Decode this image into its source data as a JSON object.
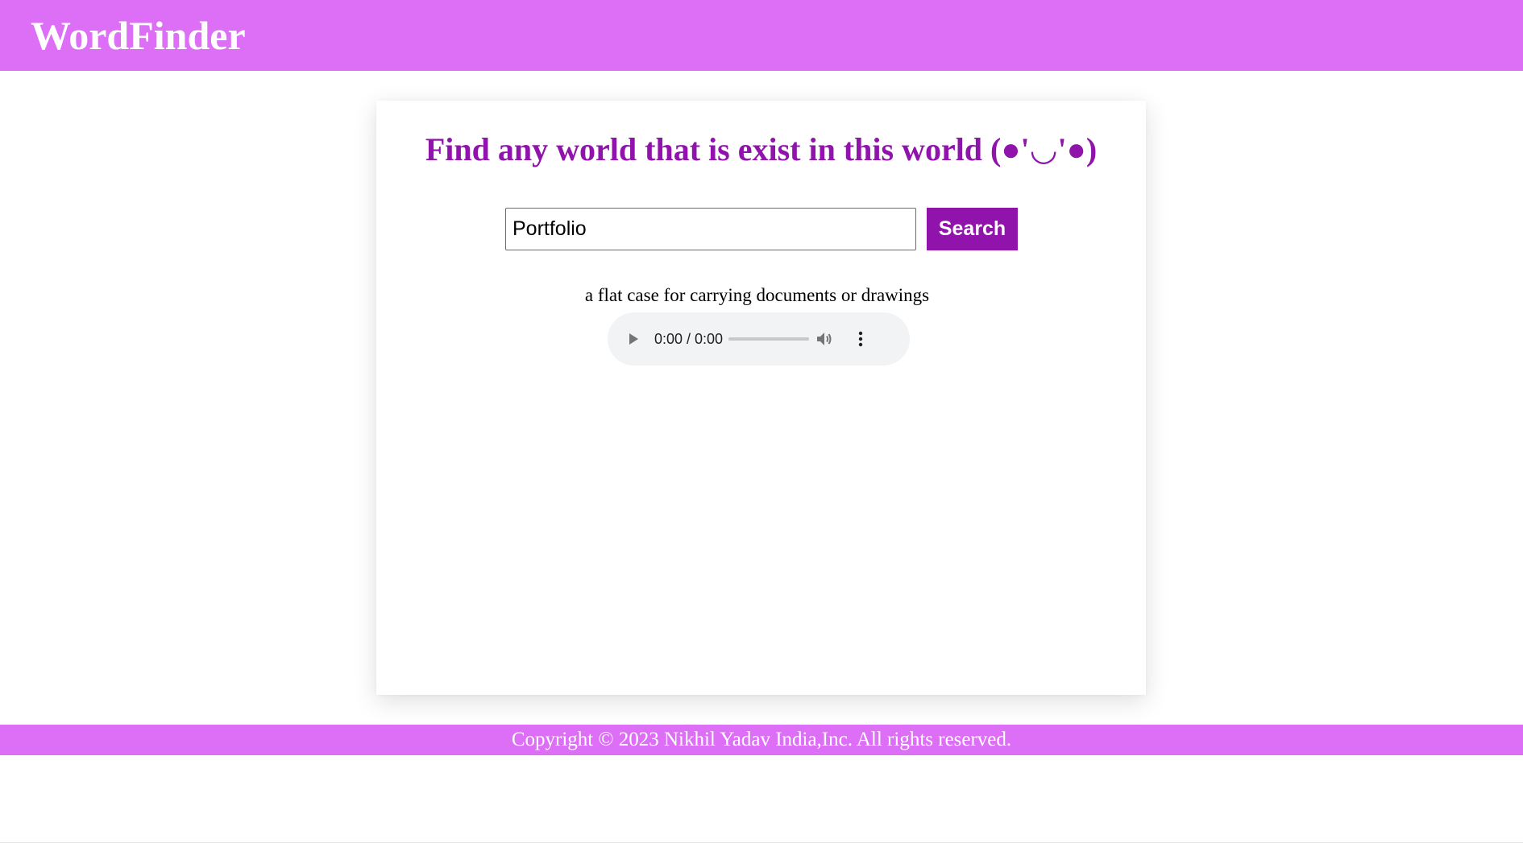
{
  "header": {
    "brand": "WordFinder"
  },
  "main": {
    "title": "Find any world that is exist in this world (●'◡'●)",
    "search": {
      "value": "Portfolio",
      "placeholder": "",
      "button_label": "Search"
    },
    "result": {
      "definition": "a flat case for carrying documents or drawings",
      "audio": {
        "time": "0:00 / 0:00",
        "progress": 0,
        "icons": [
          "play-icon",
          "volume-icon",
          "more-options-icon"
        ]
      }
    }
  },
  "footer": {
    "copyright": "Copyright © 2023 Nikhil Yadav India,Inc. All rights reserved."
  },
  "colors": {
    "header_bg": "#dd6ef6",
    "accent": "#9013ab",
    "footer_bg": "#dd6ef6",
    "audio_bg": "#f1f3f4"
  }
}
